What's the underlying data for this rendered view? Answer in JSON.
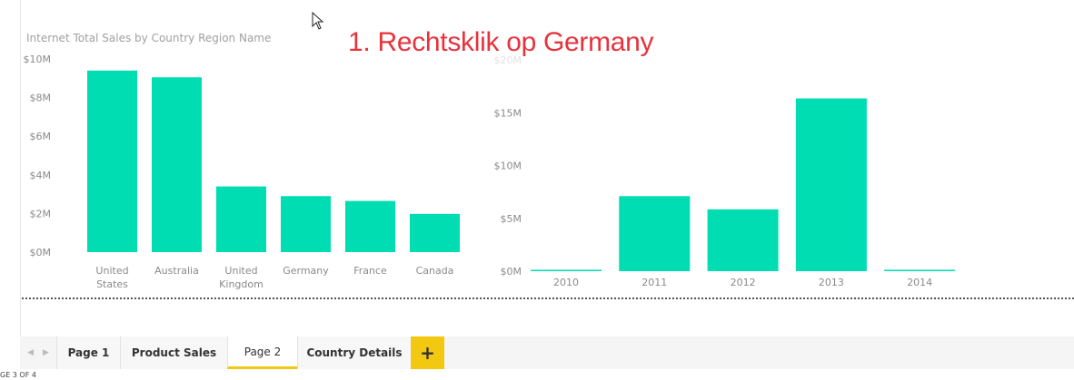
{
  "annotation": "1. Rechtsklik op Germany",
  "chart_data": [
    {
      "type": "bar",
      "title": "Internet Total Sales by Country Region Name",
      "categories": [
        "United States",
        "Australia",
        "United Kingdom",
        "Germany",
        "France",
        "Canada"
      ],
      "category_lines": [
        [
          "United",
          "States"
        ],
        [
          "Australia"
        ],
        [
          "United",
          "Kingdom"
        ],
        [
          "Germany"
        ],
        [
          "France"
        ],
        [
          "Canada"
        ]
      ],
      "values": [
        9.4,
        9.05,
        3.4,
        2.9,
        2.65,
        1.98
      ],
      "value_unit": "M",
      "ylim": [
        0,
        10
      ],
      "y_ticks": [
        0,
        2,
        4,
        6,
        8,
        10
      ],
      "y_tick_labels": [
        "$0M",
        "$2M",
        "$4M",
        "$6M",
        "$8M",
        "$10M"
      ],
      "color": "#01DDB2"
    },
    {
      "type": "bar",
      "title": "",
      "categories": [
        "2010",
        "2011",
        "2012",
        "2013",
        "2014"
      ],
      "values": [
        0.05,
        7.1,
        5.85,
        16.35,
        0.05
      ],
      "value_unit": "M",
      "ylim": [
        0,
        20
      ],
      "y_ticks": [
        0,
        5,
        10,
        15,
        20
      ],
      "y_tick_labels": [
        "$0M",
        "$5M",
        "$10M",
        "$15M",
        "$20M"
      ],
      "color": "#01DDB2"
    }
  ],
  "tabs": [
    {
      "label": "Page 1",
      "active": false
    },
    {
      "label": "Product Sales",
      "active": false
    },
    {
      "label": "Page 2",
      "active": true
    },
    {
      "label": "Country Details",
      "active": false
    }
  ],
  "add_tab_label": "+",
  "page_status": "GE 3 OF 4"
}
